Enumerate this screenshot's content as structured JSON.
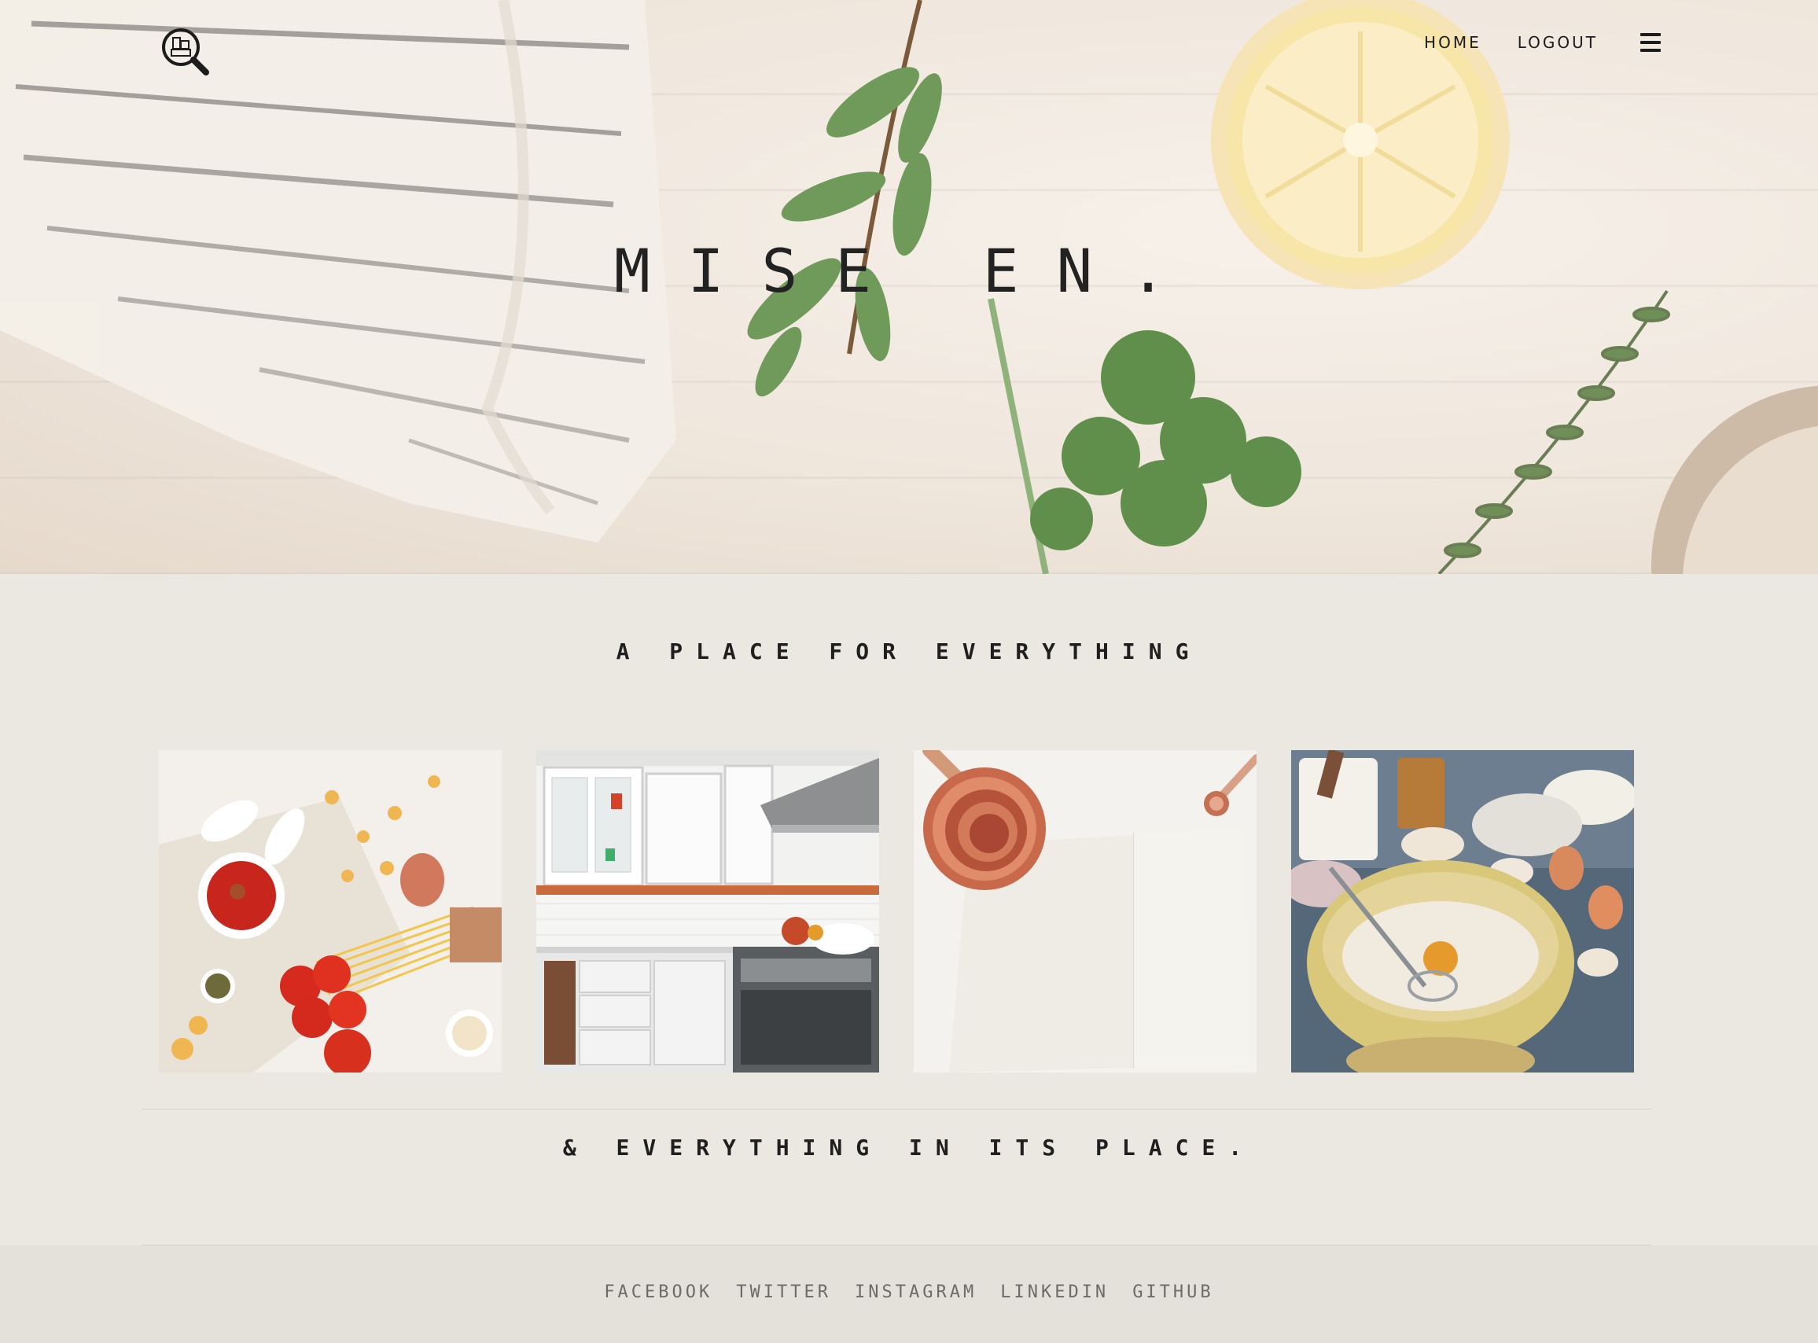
{
  "header": {
    "nav": [
      {
        "label": "HOME"
      },
      {
        "label": "LOGOUT"
      }
    ]
  },
  "hero": {
    "title": "MISE EN."
  },
  "section": {
    "tagline_top": "A PLACE FOR EVERYTHING",
    "tagline_bottom": "& EVERYTHING IN ITS PLACE."
  },
  "gallery": {
    "images": [
      {
        "name": "pasta-ingredients-image"
      },
      {
        "name": "white-kitchen-image"
      },
      {
        "name": "measuring-cups-notebook-image"
      },
      {
        "name": "baking-bowl-eggs-image"
      }
    ]
  },
  "footer": {
    "links": [
      {
        "label": "FACEBOOK"
      },
      {
        "label": "TWITTER"
      },
      {
        "label": "INSTAGRAM"
      },
      {
        "label": "LINKEDIN"
      },
      {
        "label": "GITHUB"
      }
    ]
  },
  "colors": {
    "page_background": "#ebe8e2",
    "footer_background": "#e4e1db",
    "text": "#1c1c1c",
    "footer_text": "#6d6b68"
  }
}
